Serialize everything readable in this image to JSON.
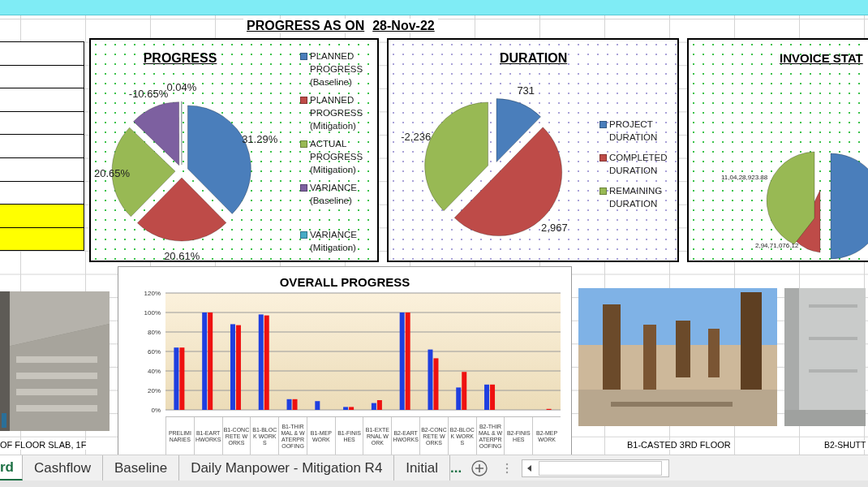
{
  "sheet_title": {
    "label": "PROGRESS AS ON",
    "date": "28-Nov-22"
  },
  "progress_chart": {
    "slice_labels": [
      "31.29%",
      "20.61%",
      "20.65%",
      "-10.65%",
      "0.04%"
    ],
    "chart_data": {
      "type": "pie",
      "title": "PROGRESS",
      "legend": "right",
      "colors": [
        "#4a7ebb",
        "#be4b48",
        "#98b954",
        "#7d60a0",
        "#46aac5"
      ],
      "categories": [
        "PLANNED PROGRESS (Baseline)",
        "PLANNED PROGRESS (Mitigation)",
        "ACTUAL PROGRESS (Mitigation)",
        "VARIANCE (Baseline)",
        "VARIANCE (Mitigation)"
      ],
      "values": [
        37.59,
        24.76,
        24.81,
        12.79,
        0.05
      ]
    }
  },
  "duration_chart": {
    "slice_labels": [
      "731",
      "2,967",
      "-2,236"
    ],
    "chart_data": {
      "type": "pie",
      "title": "DURATION",
      "legend": "right",
      "colors": [
        "#4a7ebb",
        "#be4b48",
        "#98b954"
      ],
      "categories": [
        "PROJECT DURATION",
        "COMPLETED DURATION",
        "REMAINING DURATION"
      ],
      "values": [
        12.32,
        50.0,
        37.68
      ]
    }
  },
  "invoice_chart": {
    "title": "INVOICE STAT",
    "labels": [
      "11,04,28,923.88",
      "2,94,71,076.12"
    ]
  },
  "overall_chart": {
    "chart_data": {
      "type": "bar",
      "title": "OVERALL PROGRESS",
      "grid": true,
      "categories": [
        "PRELIMINARIES",
        "B1-EARTHWORKS",
        "B1-CONCRETE WORKS",
        "B1-BLOCK WORKS",
        "B1-THIRMAL & WATERPROOFING",
        "B1-MEP WORK",
        "B1-FINISHES",
        "B1-EXTERNAL WORK",
        "B2-EARTHWORKS",
        "B2-CONCRETE WORKS",
        "B2-BLOCK WORKS",
        "B2-THIRMAL & WATERPROOFING",
        "B2-FINISHES",
        "B2-MEP WORK"
      ],
      "series": [
        {
          "color": "#1f3fe0",
          "values": [
            0.64,
            1.0,
            0.88,
            0.98,
            0.11,
            0.09,
            0.03,
            0.07,
            1.0,
            0.62,
            0.23,
            0.26,
            0,
            0
          ]
        },
        {
          "color": "#ee1111",
          "values": [
            0.64,
            1.0,
            0.87,
            0.97,
            0.11,
            0,
            0.03,
            0.1,
            1.0,
            0.53,
            0.39,
            0.26,
            0,
            0.01
          ]
        }
      ],
      "ylim": [
        0,
        1.2
      ],
      "yticks": [
        {
          "value": 0,
          "label": "0%"
        },
        {
          "value": 0.2,
          "label": "20%"
        },
        {
          "value": 0.4,
          "label": "40%"
        },
        {
          "value": 0.6,
          "label": "60%"
        },
        {
          "value": 0.8,
          "label": "80%"
        },
        {
          "value": 1.0,
          "label": "100%"
        },
        {
          "value": 1.2,
          "label": "120%"
        }
      ]
    }
  },
  "photos": [
    {
      "kind": "picture",
      "caption": "OF FLOOR SLAB, 1F"
    },
    {
      "kind": "picture",
      "caption": "B1-CASTED 3RD FLOOR"
    },
    {
      "kind": "picture",
      "caption": "B2-SHUTT"
    }
  ],
  "sheet_tabs": [
    {
      "label": "rd",
      "selected": true
    },
    {
      "label": "Cashflow",
      "selected": false
    },
    {
      "label": "Baseline",
      "selected": false
    },
    {
      "label": "Daily Manpower - Mitigation R4",
      "selected": false
    },
    {
      "label": "Initial",
      "selected": false
    }
  ],
  "more_tabs": "..."
}
